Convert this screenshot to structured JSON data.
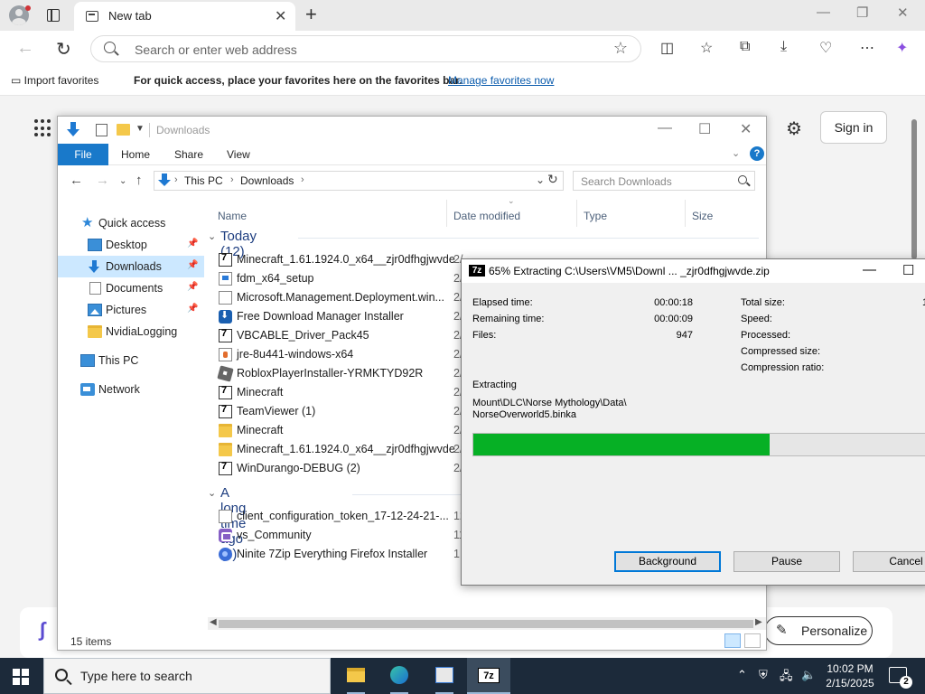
{
  "browser": {
    "tab_title": "New tab",
    "address_placeholder": "Search or enter web address",
    "favorites_bar": {
      "import_label": "Import favorites",
      "message": "For quick access, place your favorites here on the favorites bar.",
      "link": "Manage favorites now"
    },
    "new_tab_page": {
      "sign_in_label": "Sign in",
      "personalize_label": "Personalize"
    }
  },
  "explorer": {
    "title": "Downloads",
    "ribbon_tabs": [
      "File",
      "Home",
      "Share",
      "View"
    ],
    "breadcrumb": [
      "This PC",
      "Downloads"
    ],
    "search_placeholder": "Search Downloads",
    "columns": [
      "Name",
      "Date modified",
      "Type",
      "Size"
    ],
    "sidebar": [
      {
        "label": "Quick access",
        "icon": "star-icon"
      },
      {
        "label": "Desktop",
        "icon": "desktop-icon",
        "pinned": true
      },
      {
        "label": "Downloads",
        "icon": "downloads-icon",
        "pinned": true,
        "selected": true
      },
      {
        "label": "Documents",
        "icon": "documents-icon",
        "pinned": true
      },
      {
        "label": "Pictures",
        "icon": "pictures-icon",
        "pinned": true
      },
      {
        "label": "NvidiaLogging",
        "icon": "folder-icon"
      },
      {
        "label": "This PC",
        "icon": "this-pc-icon"
      },
      {
        "label": "Network",
        "icon": "network-icon"
      }
    ],
    "groups": [
      {
        "label": "Today (12)",
        "files": [
          {
            "name": "Minecraft_1.61.1924.0_x64__zjr0dfhgjwvde",
            "date": "2/",
            "icon": "zip"
          },
          {
            "name": "fdm_x64_setup",
            "date": "2/",
            "icon": "installer"
          },
          {
            "name": "Microsoft.Management.Deployment.win...",
            "date": "2/",
            "icon": "doc"
          },
          {
            "name": "Free Download Manager Installer",
            "date": "2/",
            "icon": "fdm"
          },
          {
            "name": "VBCABLE_Driver_Pack45",
            "date": "2/",
            "icon": "zip"
          },
          {
            "name": "jre-8u441-windows-x64",
            "date": "2/",
            "icon": "java"
          },
          {
            "name": "RobloxPlayerInstaller-YRMKTYD92R",
            "date": "2/",
            "icon": "roblox"
          },
          {
            "name": "Minecraft",
            "date": "2/",
            "icon": "zip"
          },
          {
            "name": "TeamViewer (1)",
            "date": "2/",
            "icon": "zip"
          },
          {
            "name": "Minecraft",
            "date": "2/",
            "icon": "folder"
          },
          {
            "name": "Minecraft_1.61.1924.0_x64__zjr0dfhgjwvde",
            "date": "2/",
            "icon": "folder"
          },
          {
            "name": "WinDurango-DEBUG (2)",
            "date": "2/",
            "icon": "zip"
          }
        ]
      },
      {
        "label": "A long time ago (3)",
        "files": [
          {
            "name": "client_configuration_token_17-12-24-21-...",
            "date": "12",
            "icon": "doc"
          },
          {
            "name": "vs_Community",
            "date": "11",
            "icon": "vs"
          },
          {
            "name": "Ninite 7Zip Everything Firefox Installer",
            "date": "1",
            "icon": "ninite"
          }
        ]
      }
    ],
    "status": "15 items"
  },
  "sevenzip": {
    "title": "65% Extracting C:\\Users\\VM5\\Downl ... _zjr0dfhgjwvde.zip",
    "progress_percent": 65,
    "left_stats": [
      {
        "label": "Elapsed time:",
        "value": "00:00:18"
      },
      {
        "label": "Remaining time:",
        "value": "00:00:09"
      },
      {
        "label": "Files:",
        "value": "947"
      }
    ],
    "right_stats": [
      {
        "label": "Total size:",
        "value": "1"
      },
      {
        "label": "Speed:",
        "value": ""
      },
      {
        "label": "Processed:",
        "value": ""
      },
      {
        "label": "Compressed size:",
        "value": ""
      },
      {
        "label": "Compression ratio:",
        "value": ""
      }
    ],
    "operation": "Extracting",
    "path_line1": "Mount\\DLC\\Norse Mythology\\Data\\",
    "path_line2": "NorseOverworld5.binka",
    "buttons": {
      "background": "Background",
      "pause": "Pause",
      "cancel": "Cancel"
    },
    "colors": {
      "progress": "#06b025"
    }
  },
  "taskbar": {
    "search_placeholder": "Type here to search",
    "apps": [
      "file-explorer-icon",
      "edge-icon",
      "app-icon",
      "7zip-icon"
    ],
    "time": "10:02 PM",
    "date": "2/15/2025",
    "notification_count": "2"
  }
}
